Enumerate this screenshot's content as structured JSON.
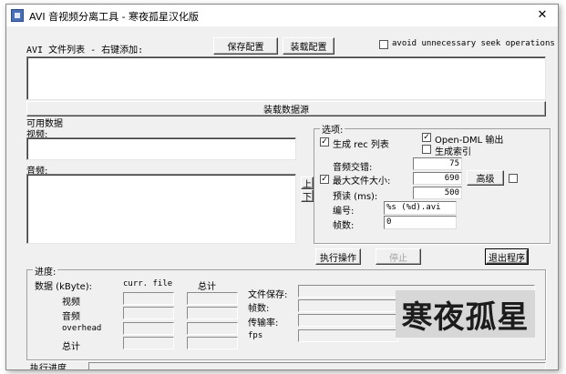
{
  "window": {
    "title": "AVI 音视频分离工具 - 寒夜孤星汉化版",
    "close_glyph": "✕"
  },
  "top": {
    "list_label": "AVI 文件列表 - 右键添加:",
    "save_config": "保存配置",
    "load_config": "装载配置",
    "avoid_seek": "avoid unnecessary seek operations",
    "load_source": "装载数据源"
  },
  "available": {
    "title": "可用数据",
    "video": "视频:",
    "audio": "音频:",
    "move_up": "上",
    "move_down": "下"
  },
  "options": {
    "title": "选项:",
    "gen_rec": "生成 rec 列表",
    "gen_rec_checked": "✓",
    "opendml": "Open-DML 输出",
    "opendml_checked": "✓",
    "gen_index": "生成索引",
    "audio_interleave": "音频交错:",
    "audio_interleave_value": "75",
    "max_file_size": "最大文件大小:",
    "max_file_size_checked": "✓",
    "max_file_size_value": "690",
    "advanced": "高级",
    "preload": "预读 (ms):",
    "preload_value": "500",
    "numbering": "编号:",
    "numbering_value": "%s (%d).avi",
    "frames": "帧数:",
    "frames_value": "0"
  },
  "actions": {
    "execute": "执行操作",
    "stop": "停止",
    "exit": "退出程序"
  },
  "progress": {
    "title": "进度:",
    "data_label": "数据 (kByte):",
    "curr_file": "curr. file",
    "total": "总计",
    "rows": [
      "视频",
      "音频",
      "overhead",
      "总计"
    ],
    "file_save": "文件保存:",
    "frames": "帧数:",
    "transfer_rate": "传输率:",
    "fps": "fps",
    "exec_progress": "执行进度"
  },
  "watermark": {
    "text": "寒夜孤星"
  },
  "colors": {
    "face": "#f0f0f0",
    "watermark_bg": "#d7d7d7",
    "watermark_ink": "#1c1c1c"
  }
}
